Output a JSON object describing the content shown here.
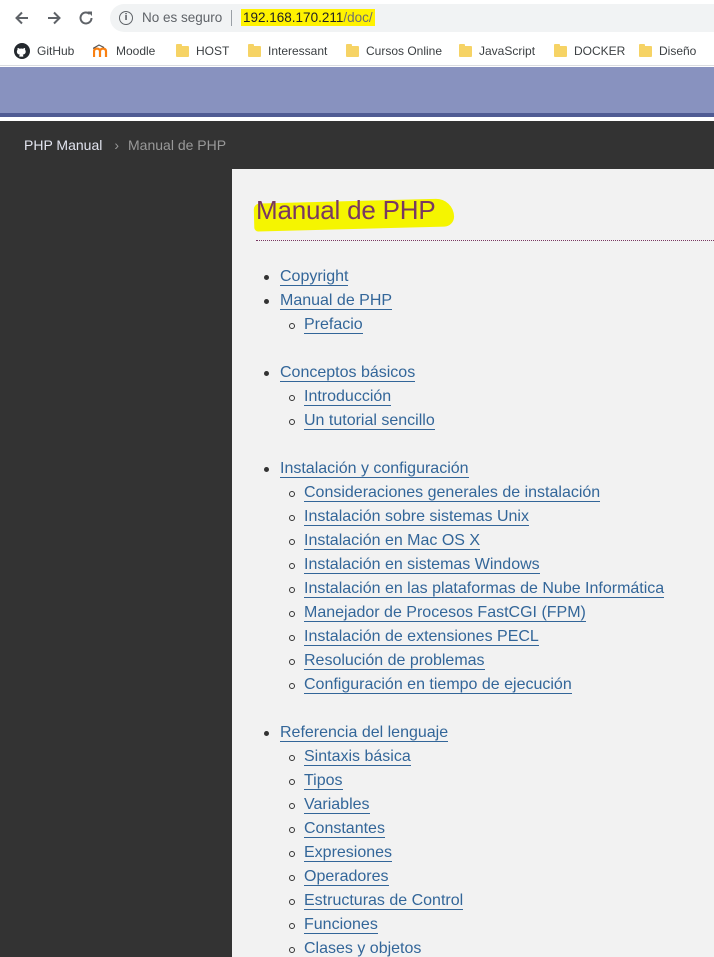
{
  "browser": {
    "security_label": "No es seguro",
    "url_host": "192.168.170.211",
    "url_path": "/doc/",
    "highlight_color": "#fff200",
    "bookmarks": [
      {
        "label": "GitHub",
        "icon": "github-icon"
      },
      {
        "label": "Moodle",
        "icon": "moodle-icon"
      },
      {
        "label": "HOST",
        "icon": "folder-icon"
      },
      {
        "label": "Interessant",
        "icon": "folder-icon"
      },
      {
        "label": "Cursos Online",
        "icon": "folder-icon"
      },
      {
        "label": "JavaScript",
        "icon": "folder-icon"
      },
      {
        "label": "DOCKER",
        "icon": "folder-icon"
      },
      {
        "label": "Diseño",
        "icon": "folder-icon"
      }
    ]
  },
  "breadcrumb": {
    "home": "PHP Manual",
    "separator": "›",
    "current": "Manual de PHP"
  },
  "page": {
    "title": "Manual de PHP",
    "colors": {
      "banner": "#8892bf",
      "title": "#793862",
      "link": "#336699",
      "title_highlight": "#f5f500"
    }
  },
  "toc": [
    {
      "label": "Copyright",
      "children": []
    },
    {
      "label": "Manual de PHP",
      "children": [
        "Prefacio"
      ]
    },
    {
      "label": "Conceptos básicos",
      "children": [
        "Introducción",
        "Un tutorial sencillo"
      ]
    },
    {
      "label": "Instalación y configuración",
      "children": [
        "Consideraciones generales de instalación",
        "Instalación sobre sistemas Unix",
        "Instalación en Mac OS X",
        "Instalación en sistemas Windows",
        "Instalación en las plataformas de Nube Informática",
        "Manejador de Procesos FastCGI (FPM)",
        "Instalación de extensiones PECL",
        "Resolución de problemas",
        "Configuración en tiempo de ejecución"
      ]
    },
    {
      "label": "Referencia del lenguaje",
      "children": [
        "Sintaxis básica",
        "Tipos",
        "Variables",
        "Constantes",
        "Expresiones",
        "Operadores",
        "Estructuras de Control",
        "Funciones",
        "Clases y objetos"
      ]
    }
  ]
}
